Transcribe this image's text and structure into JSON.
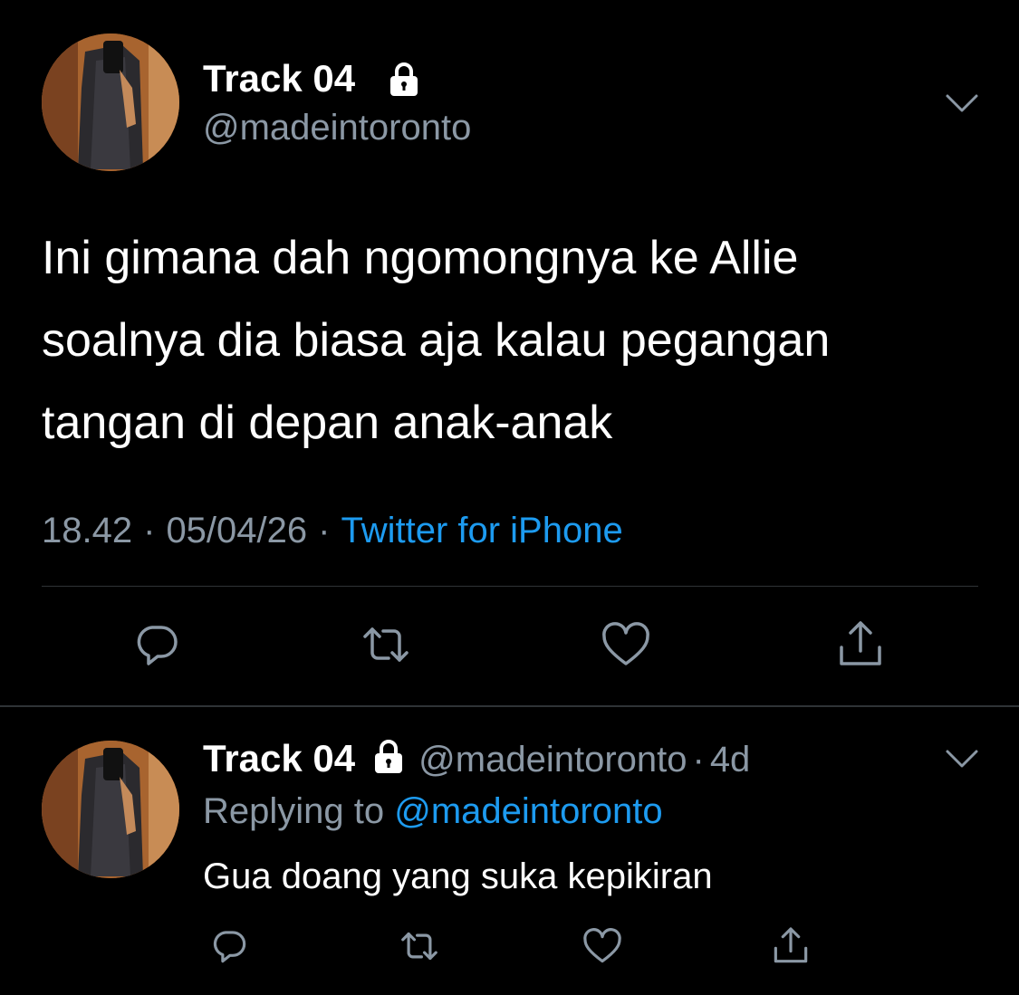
{
  "tweet": {
    "display_name": "Track 04",
    "handle": "@madeintoronto",
    "text": "Ini gimana dah ngomongnya ke Allie\nsoalnya dia biasa aja kalau pegangan\ntangan di depan anak-anak",
    "time": "18.42",
    "date": "05/04/26",
    "separator": "·",
    "source": "Twitter for iPhone",
    "icons": {
      "avatar": "avatar-photo",
      "lock": "lock-icon",
      "menu": "chevron-down-icon",
      "reply": "reply-icon",
      "retweet": "retweet-icon",
      "like": "heart-icon",
      "share": "share-icon"
    }
  },
  "reply": {
    "display_name": "Track 04",
    "handle": "@madeintoronto",
    "separator": "·",
    "time_ago": "4d",
    "replying_label": "Replying to",
    "replying_to": "@madeintoronto",
    "text": "Gua doang yang suka kepikiran"
  },
  "colors": {
    "background": "#000000",
    "text_primary": "#ffffff",
    "text_secondary": "#8b98a5",
    "accent": "#1d9bf0",
    "divider": "#2f3336"
  }
}
